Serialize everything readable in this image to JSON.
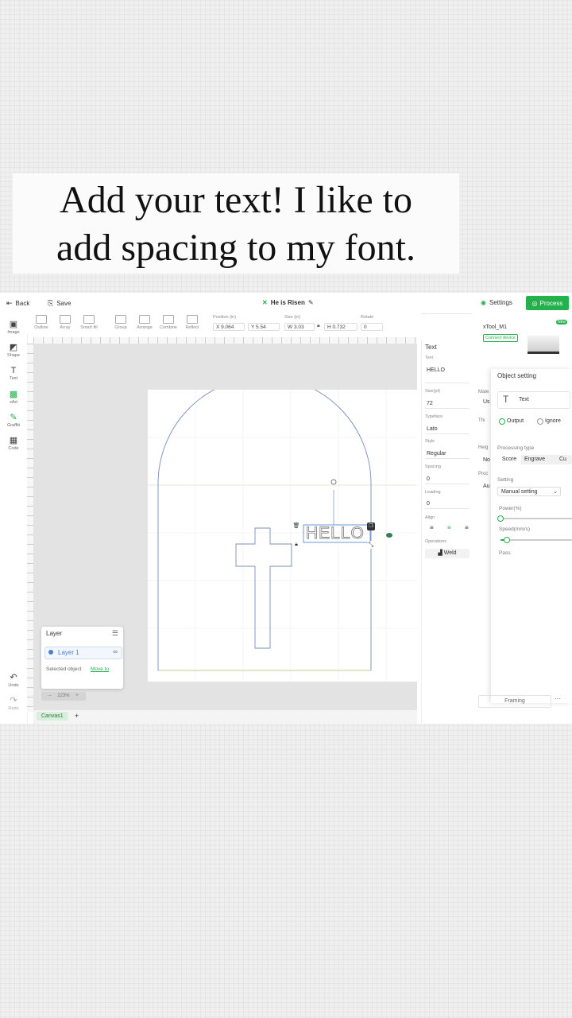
{
  "caption": {
    "line1": "Add your text! I like to",
    "line2": "add spacing to my font."
  },
  "topbar": {
    "back": "Back",
    "save": "Save",
    "project_title": "He is Risen",
    "settings": "Settings",
    "process": "Process"
  },
  "toolbar": {
    "tools": [
      "Outline",
      "Array",
      "Smart fill",
      "Group",
      "Arrange",
      "Combine",
      "Reflect"
    ],
    "position_label": "Position (in)",
    "x_value": "X 9.064",
    "y_value": "Y 5.54",
    "size_label": "Size (in)",
    "w_value": "W 3.03",
    "h_value": "H 0.732",
    "rotate_label": "Rotate",
    "rotate_value": "0"
  },
  "leftbar": [
    "Image",
    "Shape",
    "Text",
    "xArt",
    "Graffiti",
    "Code"
  ],
  "leftbar_bottom": [
    "Undo",
    "Redo"
  ],
  "canvas": {
    "text_object": "HELLO"
  },
  "layer_panel": {
    "title": "Layer",
    "layer_name": "Layer 1",
    "selected_text": "Selected object",
    "move_to": "Move to"
  },
  "zoom": "223%",
  "tabs": {
    "canvas1": "Canvas1",
    "add": "+"
  },
  "text_panel": {
    "title": "Text",
    "text_label": "Text",
    "text_value": "HELLO",
    "size_label": "Size(pt)",
    "size_value": "72",
    "typeface_label": "Typeface",
    "typeface_value": "Lato",
    "style_label": "Style",
    "style_value": "Regular",
    "spacing_label": "Spacing",
    "spacing_value": "0",
    "leading_label": "Leading",
    "leading_value": "0",
    "align_label": "Align",
    "operation_label": "Operations",
    "weld": "Weld"
  },
  "object_panel": {
    "device_name": "xTool_M1",
    "connect": "Connect device",
    "new_badge": "New",
    "title": "Object setting",
    "object_type": "Text",
    "output": "Output",
    "ignore": "Ignore",
    "processing_type": "Processing type",
    "score": "Score",
    "engrave": "Engrave",
    "cut": "Cu",
    "setting": "Setting",
    "manual_setting": "Manual setting",
    "power": "Power(%)",
    "speed": "Speed(mm/s)",
    "pass": "Pass",
    "framing": "Framing",
    "peek_mate": "Mate",
    "peek_us": "Us",
    "peek_thi": "Thi",
    "peek_heig": "Heig",
    "peek_no": "No",
    "peek_proc": "Proc",
    "peek_au": "Au"
  },
  "colors": {
    "accent": "#22b14c",
    "selection": "#4a7fd4"
  }
}
